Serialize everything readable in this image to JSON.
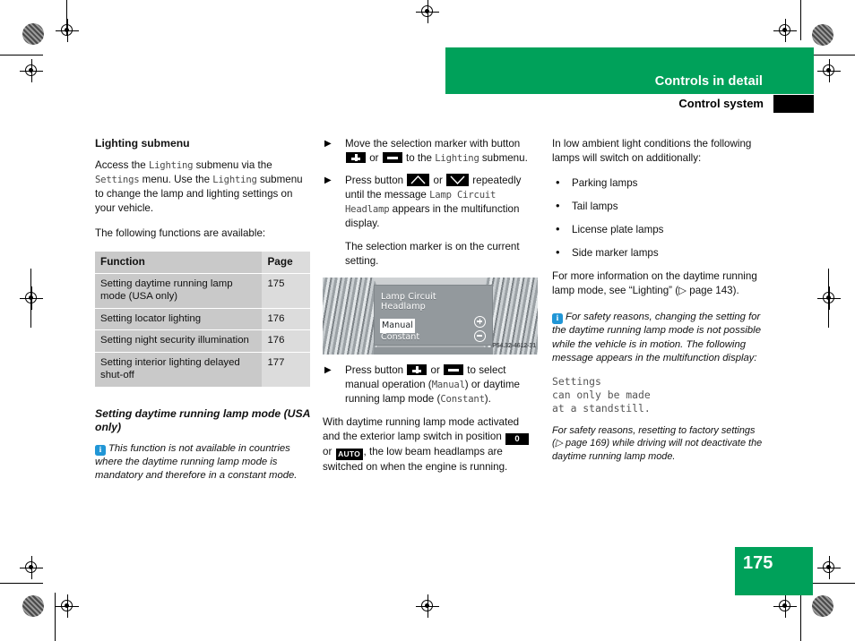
{
  "header": {
    "chapter": "Controls in detail",
    "section": "Control system"
  },
  "footer": {
    "page_number": "175"
  },
  "colors": {
    "accent_green": "#00a15a",
    "info_blue": "#2196d6",
    "table_row": "#c9c9c9",
    "table_page_col": "#dcdcdc"
  },
  "left_column": {
    "heading": "Lighting submenu",
    "intro_p1_a": "Access the ",
    "intro_p1_mono1": "Lighting",
    "intro_p1_b": " submenu via the ",
    "intro_p1_mono2": "Settings",
    "intro_p1_c": " menu. Use the ",
    "intro_p1_mono3": "Lighting",
    "intro_p1_d": " submenu to change the lamp and lighting settings on your vehicle.",
    "intro_p2": "The following functions are available:",
    "table": {
      "headers": [
        "Function",
        "Page"
      ],
      "rows": [
        {
          "function": "Setting daytime running lamp mode (USA only)",
          "page": "175"
        },
        {
          "function": "Setting locator lighting",
          "page": "176"
        },
        {
          "function": "Setting night security illumination",
          "page": "176"
        },
        {
          "function": "Setting interior lighting delayed shut-off",
          "page": "177"
        }
      ]
    },
    "subheading": "Setting daytime running lamp mode (USA only)",
    "note_icon": "info-icon",
    "note_text": "This function is not available in countries where the daytime running lamp mode is mandatory and therefore in a constant mode."
  },
  "middle_column": {
    "step1_a": "Move the selection marker with button ",
    "step1_key_plus": "plus-button",
    "step1_b": " or ",
    "step1_key_minus": "minus-button",
    "step1_c": " to the ",
    "step1_mono": "Lighting",
    "step1_d": " submenu.",
    "step2_a": "Press button ",
    "step2_key_up": "up-button",
    "step2_b": " or ",
    "step2_key_down": "down-button",
    "step2_c": " repeatedly until the message ",
    "step2_mono1": "Lamp Circuit",
    "step2_d": " ",
    "step2_mono2": "Headlamp",
    "step2_e": " appears in the multifunction display.",
    "step2_follow": "The selection marker is on the current setting.",
    "figure": {
      "display_line1": "Lamp Circuit",
      "display_line2": "Headlamp",
      "option_selected": "Manual",
      "option_other": "Constant",
      "plus_icon": "circle-plus-icon",
      "minus_icon": "circle-minus-icon",
      "caption_code": "P54.32-4612-31"
    },
    "step3_a": "Press button ",
    "step3_key_plus": "plus-button",
    "step3_b": " or ",
    "step3_key_minus": "minus-button",
    "step3_c": " to select manual operation (",
    "step3_mono1": "Manual",
    "step3_d": ") or daytime running lamp mode (",
    "step3_mono2": "Constant",
    "step3_e": ").",
    "closing_a": "With daytime running lamp mode activated and the exterior lamp switch in position ",
    "closing_key_zero": "0",
    "closing_b": " or ",
    "closing_key_auto": "AUTO",
    "closing_c": ", the low beam headlamps are switched on when the engine is running."
  },
  "right_column": {
    "intro": "In low ambient light conditions the following lamps will switch on additionally:",
    "bullets": [
      "Parking lamps",
      "Tail lamps",
      "License plate lamps",
      "Side marker lamps"
    ],
    "more_info": "For more information on the daytime running lamp mode, see “Lighting” (▷ page 143).",
    "note_text": "For safety reasons, changing the setting for the daytime running lamp mode is not possible while the vehicle is in motion. The following message appears in the multifunction display:",
    "display_message_line1": "Settings",
    "display_message_line2": "can only be made",
    "display_message_line3": "at a standstill.",
    "note_text2": "For safety reasons, resetting to factory settings (▷ page 169) while driving will not deactivate the daytime running lamp mode."
  }
}
